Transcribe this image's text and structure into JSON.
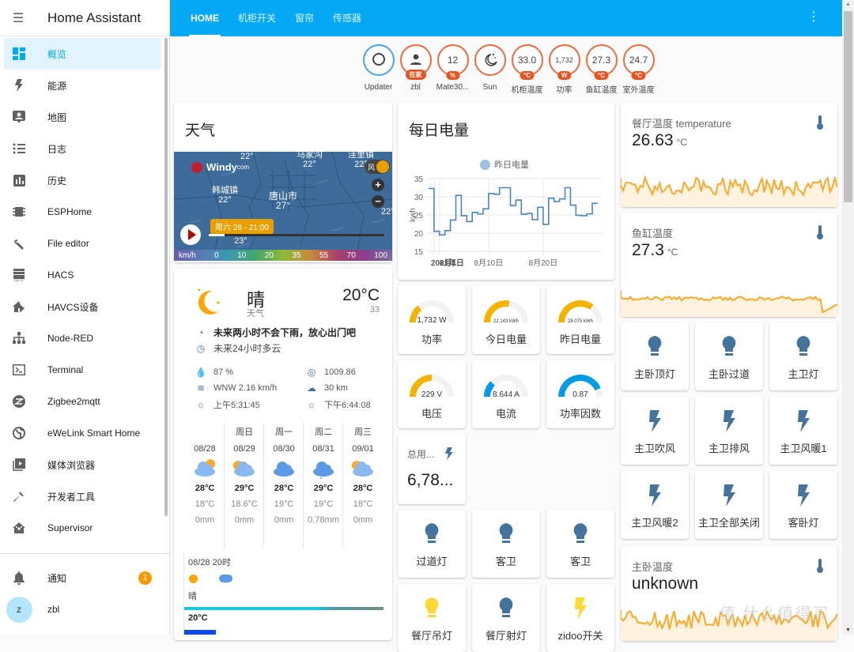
{
  "app_title": "Home Assistant",
  "sidebar": {
    "items": [
      {
        "label": "概览",
        "icon": "dashboard-icon",
        "active": true
      },
      {
        "label": "能源",
        "icon": "lightning-bolt-icon"
      },
      {
        "label": "地图",
        "icon": "map-account-icon"
      },
      {
        "label": "日志",
        "icon": "list-icon"
      },
      {
        "label": "历史",
        "icon": "chart-box-icon"
      },
      {
        "label": "ESPHome",
        "icon": "chip-icon"
      },
      {
        "label": "File editor",
        "icon": "wrench-icon"
      },
      {
        "label": "HACS",
        "icon": "hacs-icon"
      },
      {
        "label": "HAVCS设备",
        "icon": "home-edit-icon"
      },
      {
        "label": "Node-RED",
        "icon": "sitemap-icon"
      },
      {
        "label": "Terminal",
        "icon": "console-icon"
      },
      {
        "label": "Zigbee2mqtt",
        "icon": "zigbee-icon"
      },
      {
        "label": "eWeLink Smart Home",
        "icon": "earth-icon"
      },
      {
        "label": "媒体浏览器",
        "icon": "play-box-multiple-icon"
      },
      {
        "label": "开发者工具",
        "icon": "hammer-icon"
      },
      {
        "label": "Supervisor",
        "icon": "home-assistant-icon"
      }
    ],
    "notifications": {
      "label": "通知",
      "count": "1"
    },
    "user": {
      "name": "zbl",
      "initial": "z"
    }
  },
  "header": {
    "tabs": [
      {
        "label": "HOME",
        "active": true
      },
      {
        "label": "机柜开关"
      },
      {
        "label": "窗帘"
      },
      {
        "label": "传感器"
      }
    ],
    "menu_icon": "⋮"
  },
  "badges": [
    {
      "name": "Updater",
      "value": "",
      "icon": "circle-outline-icon",
      "unit": "",
      "color": "blue"
    },
    {
      "name": "zbl",
      "value": "",
      "icon": "account-icon",
      "unit": "在家"
    },
    {
      "name": "Mate30...",
      "value": "12",
      "unit": "%"
    },
    {
      "name": "Sun",
      "value": "",
      "icon": "weather-night-icon",
      "unit": ""
    },
    {
      "name": "机柜温度",
      "value": "33.0",
      "unit": "°C"
    },
    {
      "name": "功率",
      "value": "1,732",
      "unit": "W"
    },
    {
      "name": "鱼缸温度",
      "value": "27.3",
      "unit": "°C"
    },
    {
      "name": "室外温度",
      "value": "24.7",
      "unit": "°C"
    }
  ],
  "weather_card": {
    "title": "天气",
    "map": {
      "brand": "Windy",
      "brand_suffix": "com",
      "labels": [
        {
          "text": "22°"
        },
        {
          "text": "马家沟\n22°"
        },
        {
          "text": "洼里镇\n22°"
        },
        {
          "text": "韩城镇\n22°"
        },
        {
          "text": "唐山市\n27°"
        },
        {
          "text": "22°"
        },
        {
          "text": "丰南区\n23°"
        }
      ],
      "layer_label": "风",
      "time_tooltip": "周六 28 - 21:00",
      "scale": [
        "km/h",
        "0",
        "10",
        "20",
        "35",
        "55",
        "70",
        "100"
      ],
      "timeline_progress": 0.09
    },
    "current": {
      "condition": "晴",
      "subtitle": "天气",
      "temperature": "20°C",
      "secondary": "33",
      "rain_alert": "未来两小时不会下雨，放心出门吧",
      "forecast_24h": "未来24小时多云",
      "humidity": "87 %",
      "pressure": "1009.86",
      "wind": "WNW 2.16 km/h",
      "visibility": "30 km",
      "sunrise": "上午5:31:45",
      "sunset": "下午6:44:08"
    },
    "forecast": [
      {
        "day": "",
        "date": "08/28",
        "icon": "partly-cloudy-night-icon",
        "high": "28°C",
        "low": "18°C",
        "precip": "0mm"
      },
      {
        "day": "周日",
        "date": "08/29",
        "icon": "partly-sunny-icon",
        "high": "29°C",
        "low": "18.6°C",
        "precip": "0mm"
      },
      {
        "day": "周一",
        "date": "08/30",
        "icon": "cloudy-icon",
        "high": "28°C",
        "low": "19°C",
        "precip": "0mm"
      },
      {
        "day": "周二",
        "date": "08/31",
        "icon": "light-rain-icon",
        "high": "29°C",
        "low": "19°C",
        "precip": "0.78mm"
      },
      {
        "day": "周三",
        "date": "09/01",
        "icon": "partly-sunny-icon",
        "high": "28°C",
        "low": "18°C",
        "precip": "0mm"
      }
    ],
    "hourly": {
      "time": "08/28 20时",
      "condition": "晴",
      "temp": "20°C"
    }
  },
  "energy_chart": {
    "title": "每日电量",
    "chart_data": {
      "type": "line",
      "step": true,
      "series": [
        {
          "name": "昨日电量",
          "color": "#4b86c2",
          "values": [
            32.3,
            20.5,
            19.5,
            20.7,
            23.6,
            30.4,
            24.8,
            23.2,
            25.7,
            25.3,
            26.7,
            30.9,
            30.7,
            32.5,
            32.5,
            27.6,
            29.1,
            25.2,
            25.4,
            23.7,
            27.1,
            22.4,
            29.6,
            28.7,
            29.4,
            32.5,
            27.7,
            24.9,
            24.8,
            25.3,
            28.2
          ]
        }
      ],
      "x_start_day": -1,
      "xticks": [
        {
          "day": 0,
          "label": "2021年"
        },
        {
          "day": 1,
          "label": "8月1日"
        },
        {
          "day": 10,
          "label": "8月10日"
        },
        {
          "day": 20,
          "label": "8月20日"
        }
      ],
      "ylabel": "kwh",
      "ylim": [
        15,
        35
      ],
      "yticks": [
        15,
        20,
        25,
        30,
        35
      ],
      "grid": true,
      "legend": "top"
    }
  },
  "gauges": [
    {
      "label": "功率",
      "value": "1,732 W",
      "fraction": 0.28,
      "color": "#f5b300"
    },
    {
      "label": "今日电量",
      "value": "22.143 kWh",
      "fraction": 0.55,
      "color": "#f5b300"
    },
    {
      "label": "昨日电量",
      "value": "28.075 kWh",
      "fraction": 0.7,
      "color": "#f5b300"
    },
    {
      "label": "电压",
      "value": "229 V",
      "fraction": 0.5,
      "color": "#f5b300"
    },
    {
      "label": "电流",
      "value": "8.644 A",
      "fraction": 0.25,
      "color": "#039be5"
    },
    {
      "label": "功率因数",
      "value": "0.87",
      "fraction": 0.87,
      "color": "#039be5"
    }
  ],
  "total_energy": {
    "name": "总用...",
    "value": "6,78..."
  },
  "buttons_mid": [
    {
      "label": "过道灯",
      "icon": "lightbulb-icon",
      "on": false
    },
    {
      "label": "客卫",
      "icon": "lightbulb-icon",
      "on": false
    },
    {
      "label": "客卫",
      "icon": "lightbulb-icon",
      "on": false
    },
    {
      "label": "餐厅吊灯",
      "icon": "lightbulb-icon",
      "on": true
    },
    {
      "label": "餐厅射灯",
      "icon": "lightbulb-icon",
      "on": false
    },
    {
      "label": "zidoo开关",
      "icon": "flash-icon",
      "on": true
    }
  ],
  "sensors": [
    {
      "name": "餐厅温度 temperature",
      "value": "26.63",
      "unit": "°C"
    },
    {
      "name": "鱼缸温度",
      "value": "27.3",
      "unit": "°C"
    },
    {
      "name": "主卧温度",
      "value": "unknown",
      "unit": ""
    }
  ],
  "buttons_right": [
    {
      "label": "主卧顶灯",
      "icon": "lightbulb-icon"
    },
    {
      "label": "主卧过道",
      "icon": "lightbulb-icon"
    },
    {
      "label": "主卫灯",
      "icon": "lightbulb-icon"
    },
    {
      "label": "主卫吹风",
      "icon": "flash-icon"
    },
    {
      "label": "主卫排风",
      "icon": "flash-icon"
    },
    {
      "label": "主卫风暖1",
      "icon": "flash-icon"
    },
    {
      "label": "主卫风暖2",
      "icon": "flash-icon"
    },
    {
      "label": "主卫全部关闭",
      "icon": "flash-icon"
    },
    {
      "label": "客卧灯",
      "icon": "flash-icon"
    }
  ],
  "colors": {
    "primary": "#03a9f4",
    "icon_off": "#44739e",
    "icon_on": "#fdd835",
    "badge_accent": "#e8531e",
    "gauge_warn": "#f5b300",
    "spark": "#ffa726"
  },
  "watermark": "值 什么值得买"
}
